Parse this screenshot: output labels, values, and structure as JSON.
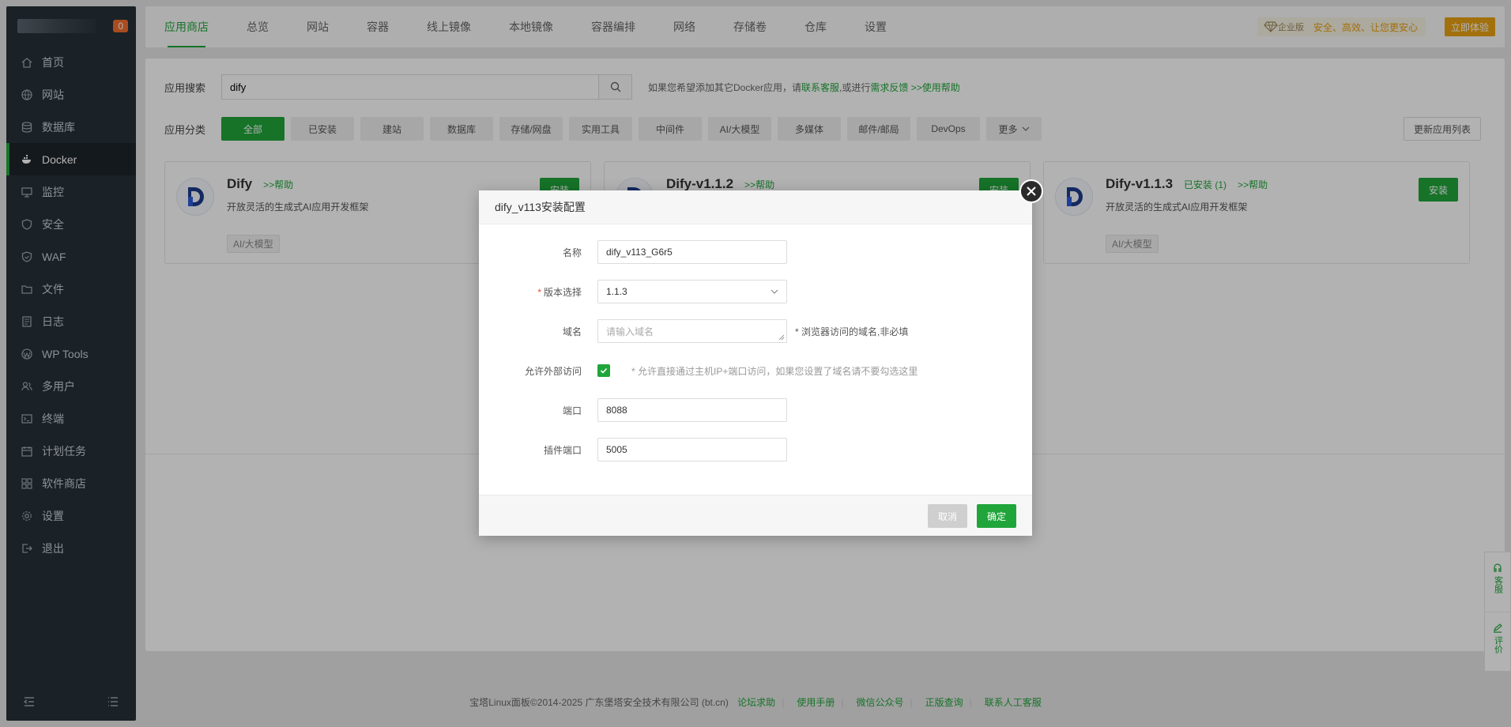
{
  "sidebar": {
    "badge": "0",
    "items": [
      {
        "label": "首页",
        "icon": "home-icon"
      },
      {
        "label": "网站",
        "icon": "globe-icon"
      },
      {
        "label": "数据库",
        "icon": "database-icon"
      },
      {
        "label": "Docker",
        "icon": "docker-icon"
      },
      {
        "label": "监控",
        "icon": "monitor-icon"
      },
      {
        "label": "安全",
        "icon": "shield-icon"
      },
      {
        "label": "WAF",
        "icon": "waf-shield-icon"
      },
      {
        "label": "文件",
        "icon": "folder-icon"
      },
      {
        "label": "日志",
        "icon": "log-icon"
      },
      {
        "label": "WP Tools",
        "icon": "wordpress-icon"
      },
      {
        "label": "多用户",
        "icon": "users-icon"
      },
      {
        "label": "终端",
        "icon": "terminal-icon"
      },
      {
        "label": "计划任务",
        "icon": "calendar-icon"
      },
      {
        "label": "软件商店",
        "icon": "grid-icon"
      },
      {
        "label": "设置",
        "icon": "gear-icon"
      },
      {
        "label": "退出",
        "icon": "logout-icon"
      }
    ]
  },
  "topbar": {
    "tabs": [
      "应用商店",
      "总览",
      "网站",
      "容器",
      "线上镜像",
      "本地镜像",
      "容器编排",
      "网络",
      "存储卷",
      "仓库",
      "设置"
    ],
    "enterprise_badge": "企业版",
    "enterprise_text": "安全、高效、让您更安心",
    "enterprise_button": "立即体验"
  },
  "search": {
    "label": "应用搜索",
    "value": "dify",
    "hint_prefix": "如果您希望添加其它Docker应用，请",
    "hint_link1": "联系客服",
    "hint_mid": ",或进行",
    "hint_link2": "需求反馈",
    "hint_link3": ">>使用帮助"
  },
  "categories": {
    "label": "应用分类",
    "items": [
      "全部",
      "已安装",
      "建站",
      "数据库",
      "存储/网盘",
      "实用工具",
      "中间件",
      "AI/大模型",
      "多媒体",
      "邮件/邮局",
      "DevOps"
    ],
    "more": "更多",
    "refresh": "更新应用列表"
  },
  "cards": [
    {
      "title": "Dify",
      "help": ">>帮助",
      "installed": "",
      "desc": "开放灵活的生成式AI应用开发框架",
      "tag": "AI/大模型",
      "button": "安装"
    },
    {
      "title": "Dify-v1.1.2",
      "help": ">>帮助",
      "installed": "",
      "desc": "",
      "tag": "",
      "button": "安装"
    },
    {
      "title": "Dify-v1.1.3",
      "help": ">>帮助",
      "installed": "已安装 (1)",
      "desc": "开放灵活的生成式AI应用开发框架",
      "tag": "AI/大模型",
      "button": "安装"
    }
  ],
  "footer": {
    "copyright": "宝塔Linux面板©2014-2025 广东堡塔安全技术有限公司 (bt.cn)",
    "links": [
      "论坛求助",
      "使用手册",
      "微信公众号",
      "正版查询",
      "联系人工客服"
    ]
  },
  "side_tools": [
    {
      "label": "客服",
      "icon": "customer-service-icon"
    },
    {
      "label": "评价",
      "icon": "edit-icon"
    }
  ],
  "modal": {
    "title": "dify_v113安装配置",
    "fields": {
      "name_label": "名称",
      "name_value": "dify_v113_G6r5",
      "version_required": "*",
      "version_label": "版本选择",
      "version_value": "1.1.3",
      "domain_label": "域名",
      "domain_placeholder": "请输入域名",
      "domain_note": "* 浏览器访问的域名,非必填",
      "external_label": "允许外部访问",
      "external_checked": true,
      "external_note": "* 允许直接通过主机IP+端口访问，如果您设置了域名请不要勾选这里",
      "port_label": "端口",
      "port_value": "8088",
      "plugin_port_label": "插件端口",
      "plugin_port_value": "5005"
    },
    "cancel": "取消",
    "confirm": "确定"
  }
}
